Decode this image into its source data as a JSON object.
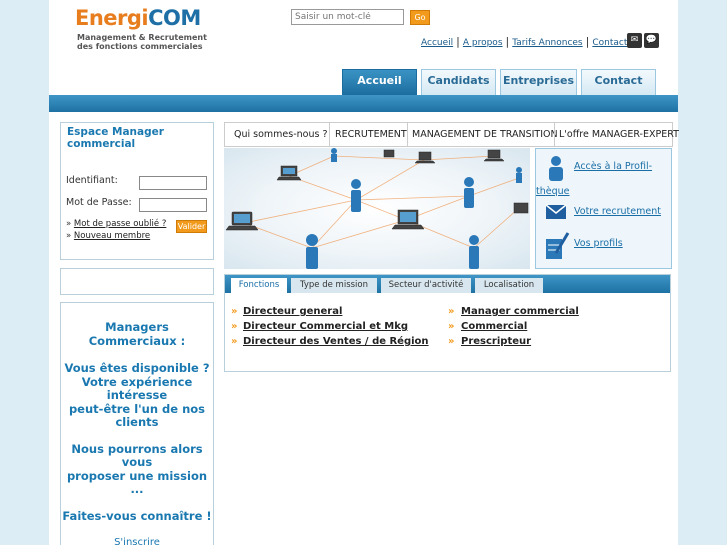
{
  "brand": {
    "part1": "Energi",
    "part2": "COM",
    "tagline_line1": "Management & Recrutement",
    "tagline_line2": "des fonctions commerciales"
  },
  "search": {
    "placeholder": "Saisir un mot-clé",
    "button": "Go"
  },
  "top_links": [
    "Accueil",
    "A propos",
    "Tarifs Annonces",
    "Contact"
  ],
  "nav": {
    "tabs": [
      "Accueil",
      "Candidats",
      "Entreprises",
      "Contact"
    ],
    "active": "Accueil"
  },
  "login": {
    "title_line1": "Espace Manager",
    "title_line2": "commercial",
    "id_label": "Identifiant:",
    "pw_label": "Mot de Passe:",
    "forgot": "Mot de passe oublié ?",
    "new_member": "Nouveau membre",
    "submit": "Valider"
  },
  "promo": {
    "heading": "Managers Commerciaux :",
    "l1": "Vous êtes disponible ?",
    "l2": "Votre expérience",
    "l3": "intéresse",
    "l4": "peut-être l'un de nos",
    "l5": "clients",
    "l6": "Nous pourrons alors",
    "l7": "vous",
    "l8": "proposer une mission ...",
    "l9": "Faites-vous connaître !",
    "link": "S'inscrire"
  },
  "sub_tabs": [
    "Qui sommes-nous ?",
    "RECRUTEMENT",
    "MANAGEMENT DE TRANSITION",
    "L'offre MANAGER-EXPERT"
  ],
  "profile": {
    "item1_line1": "Accès à la Profil-",
    "item1_line2": "thèque",
    "item2": "Votre recrutement",
    "item3": "Vos profils"
  },
  "search_tabs": {
    "tabs": [
      "Fonctions",
      "Type de mission",
      "Secteur d'activité",
      "Localisation"
    ],
    "active": "Fonctions"
  },
  "functions": {
    "left": [
      "Directeur general",
      "Directeur Commercial et Mkg",
      "Directeur des Ventes / de Région"
    ],
    "right": [
      "Manager commercial",
      "Commercial",
      "Prescripteur"
    ]
  },
  "colors": {
    "accent_orange": "#f29a1c",
    "brand_blue": "#1e6fa5",
    "nav_blue": "#1b6d9f"
  }
}
